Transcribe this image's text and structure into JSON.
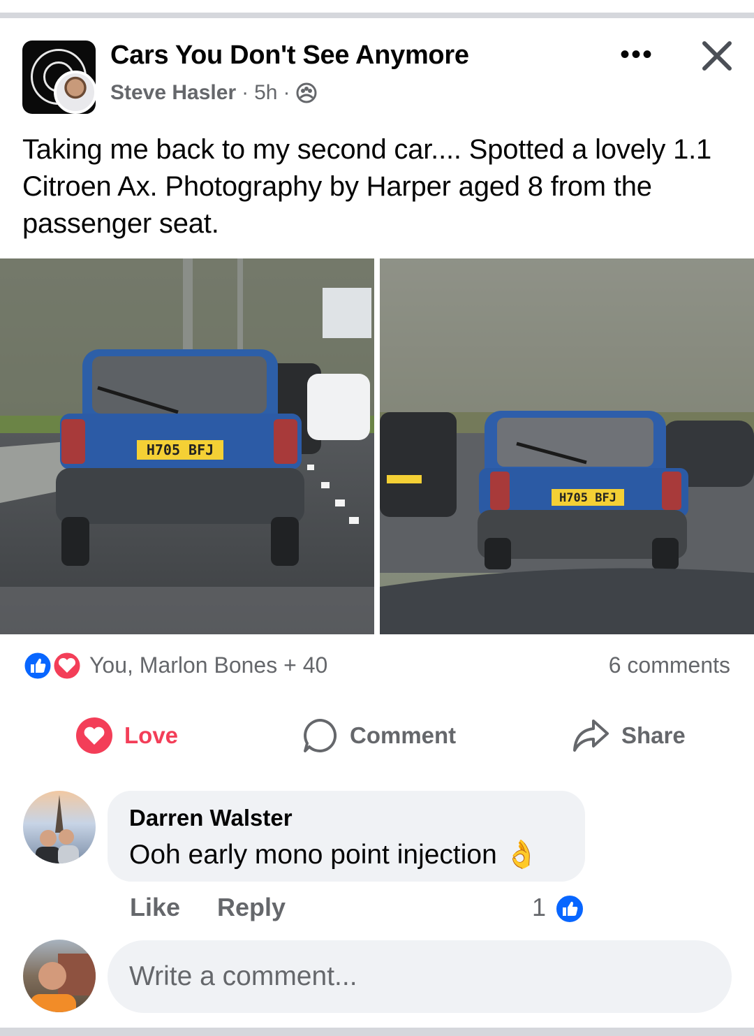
{
  "colors": {
    "accent_blue": "#0866ff",
    "love_red": "#f33e58",
    "secondary_text": "#65676b",
    "bubble_bg": "#f0f2f5"
  },
  "header": {
    "group_name": "Cars You Don't See Anymore",
    "author": "Steve Hasler",
    "sep1": "·",
    "time": "5h",
    "sep2": "·",
    "privacy_icon": "group-members-icon",
    "more_label": "•••"
  },
  "post": {
    "text": "Taking me back to my second car.... Spotted a lovely 1.1 Citroen Ax. Photography by Harper aged 8 from the passenger seat.",
    "photos": [
      {
        "plate": "H705 BFJ"
      },
      {
        "plate": "H705 BFJ"
      }
    ]
  },
  "reactions": {
    "icons": [
      "like-icon",
      "love-icon"
    ],
    "summary": "You, Marlon Bones + 40",
    "comments_count": "6 comments"
  },
  "actions": {
    "love": "Love",
    "comment": "Comment",
    "share": "Share"
  },
  "comments": [
    {
      "author": "Darren Walster",
      "text": "Ooh early mono point injection 👌",
      "like": "Like",
      "reply": "Reply",
      "reaction_count": "1"
    }
  ],
  "composer": {
    "placeholder": "Write a comment..."
  }
}
